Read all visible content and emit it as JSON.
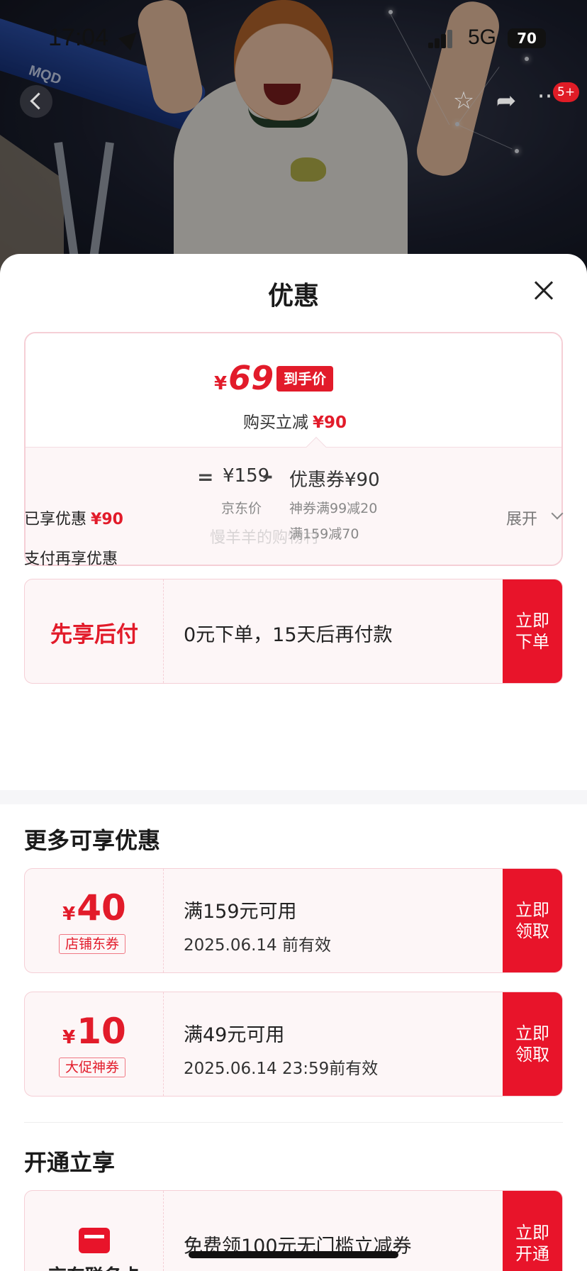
{
  "status_bar": {
    "time": "17:04",
    "network": "5G",
    "battery": "70"
  },
  "product_nav": {
    "back_icon": "chevron-left-icon",
    "star_icon": "star-icon",
    "share_icon": "share-icon",
    "more_icon": "more-icon",
    "more_label": "···",
    "badge": "5+"
  },
  "photo": {
    "brand_mark": "MQD"
  },
  "sheet": {
    "title": "优惠",
    "final_price": {
      "symbol": "¥",
      "value": "69",
      "tag": "到手价",
      "reduce_label": "购买立减",
      "reduce_amount": "¥90"
    },
    "breakdown": {
      "equals": "=",
      "jd_price": "¥159",
      "jd_label": "京东价",
      "minus": "–",
      "coupon_total": "优惠券¥90",
      "coupon_rules": [
        "神券满99减20",
        "满159减70"
      ]
    },
    "enjoyed": {
      "label": "已享优惠",
      "amount": "¥90",
      "expand_label": "展开"
    },
    "watermark": "慢羊羊的购物村",
    "pay_more_label": "支付再享优惠",
    "bnpl": {
      "label": "先享后付",
      "desc": "0元下单，15天后再付款",
      "button": "立即下单"
    },
    "more_section_title": "更多可享优惠",
    "coupons": [
      {
        "symbol": "¥",
        "amount": "40",
        "type": "店铺东券",
        "condition": "满159元可用",
        "validity": "2025.06.14 前有效",
        "button": "立即领取"
      },
      {
        "symbol": "¥",
        "amount": "10",
        "type": "大促神券",
        "condition": "满49元可用",
        "validity": "2025.06.14 23:59前有效",
        "button": "立即领取"
      }
    ],
    "open_section_title": "开通立享",
    "membership": {
      "label": "京东联名卡",
      "desc": "免费领100元无门槛立减券",
      "button": "立即开通"
    }
  },
  "colors": {
    "accent": "#e21b2a",
    "card_border": "#f5cfd6",
    "card_bg": "#fdf6f7"
  }
}
